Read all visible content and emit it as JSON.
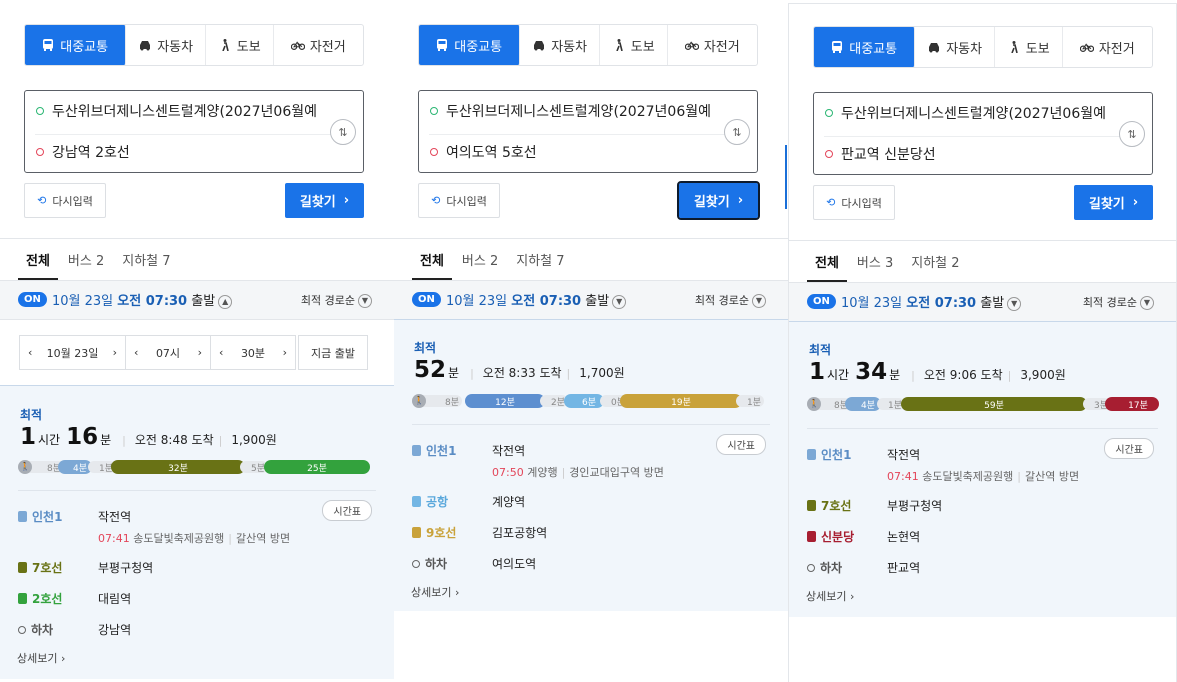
{
  "colors": {
    "accent": "#1a73e8",
    "incheon1": "#7ca8d5",
    "line7": "#697215",
    "line2": "#33a23d",
    "line9": "#bdb092",
    "airport": "#73b6e4",
    "shinbundang": "#a71e31",
    "line5": "#8b50a4"
  },
  "modes": [
    {
      "label": "대중교통",
      "icon": "bus-icon"
    },
    {
      "label": "자동차",
      "icon": "car-icon"
    },
    {
      "label": "도보",
      "icon": "walk-icon"
    },
    {
      "label": "자전거",
      "icon": "bike-icon"
    }
  ],
  "panels": [
    {
      "origin": "두산위브더제니스센트럴계양(2027년06월예",
      "destination": "강남역 2호선",
      "reset_label": "다시입력",
      "search_label": "길찾기",
      "tabs": [
        {
          "label": "전체"
        },
        {
          "label": "버스 2"
        },
        {
          "label": "지하철 7"
        }
      ],
      "on": "ON",
      "date": "10월 23일",
      "time": "오전 07:30",
      "depart": "출발",
      "sort": "최적 경로순",
      "picker": {
        "date": "10월 23일",
        "hour": "07시",
        "minute": "30분",
        "now": "지금 출발"
      },
      "result": {
        "badge": "최적",
        "hours": "1",
        "hours_unit": "시간",
        "minutes": "16",
        "minutes_unit": "분",
        "arrive": "오전 8:48 도착",
        "fare": "1,900원",
        "timeline": [
          "8분",
          "4분",
          "1분",
          "32분",
          "5분",
          "25분"
        ],
        "steps": [
          {
            "line": "인천1",
            "station": "작전역",
            "time": "07:41",
            "dest": "송도달빛축제공원행",
            "dir": "갈산역 방면",
            "tt": "시간표"
          },
          {
            "line": "7호선",
            "station": "부평구청역"
          },
          {
            "line": "2호선",
            "station": "대림역"
          },
          {
            "line": "하차",
            "station": "강남역"
          }
        ],
        "more": "상세보기"
      }
    },
    {
      "origin": "두산위브더제니스센트럴계양(2027년06월예",
      "destination": "여의도역 5호선",
      "reset_label": "다시입력",
      "search_label": "길찾기",
      "tabs": [
        {
          "label": "전체"
        },
        {
          "label": "버스 2"
        },
        {
          "label": "지하철 7"
        }
      ],
      "on": "ON",
      "date": "10월 23일",
      "time": "오전 07:30",
      "depart": "출발",
      "sort": "최적 경로순",
      "result": {
        "badge": "최적",
        "minutes": "52",
        "minutes_unit": "분",
        "arrive": "오전 8:33 도착",
        "fare": "1,700원",
        "timeline": [
          "8분",
          "12분",
          "2분",
          "6분",
          "0분",
          "19분",
          "1분"
        ],
        "steps": [
          {
            "line": "인천1",
            "station": "작전역",
            "time": "07:50",
            "dest": "계양행",
            "dir": "경인교대입구역 방면",
            "tt": "시간표"
          },
          {
            "line": "공항",
            "station": "계양역"
          },
          {
            "line": "9호선",
            "station": "김포공항역"
          },
          {
            "line": "하차",
            "station": "여의도역"
          }
        ],
        "more": "상세보기"
      }
    },
    {
      "origin": "두산위브더제니스센트럴계양(2027년06월예",
      "destination": "판교역 신분당선",
      "reset_label": "다시입력",
      "search_label": "길찾기",
      "tabs": [
        {
          "label": "전체"
        },
        {
          "label": "버스 3"
        },
        {
          "label": "지하철 2"
        }
      ],
      "on": "ON",
      "date": "10월 23일",
      "time": "오전 07:30",
      "depart": "출발",
      "sort": "최적 경로순",
      "result": {
        "badge": "최적",
        "hours": "1",
        "hours_unit": "시간",
        "minutes": "34",
        "minutes_unit": "분",
        "arrive": "오전 9:06 도착",
        "fare": "3,900원",
        "timeline": [
          "8분",
          "4분",
          "1분",
          "59분",
          "3분",
          "17분"
        ],
        "steps": [
          {
            "line": "인천1",
            "station": "작전역",
            "time": "07:41",
            "dest": "송도달빛축제공원행",
            "dir": "갈산역 방면",
            "tt": "시간표"
          },
          {
            "line": "7호선",
            "station": "부평구청역"
          },
          {
            "line": "신분당",
            "station": "논현역"
          },
          {
            "line": "하차",
            "station": "판교역"
          }
        ],
        "more": "상세보기"
      }
    }
  ]
}
